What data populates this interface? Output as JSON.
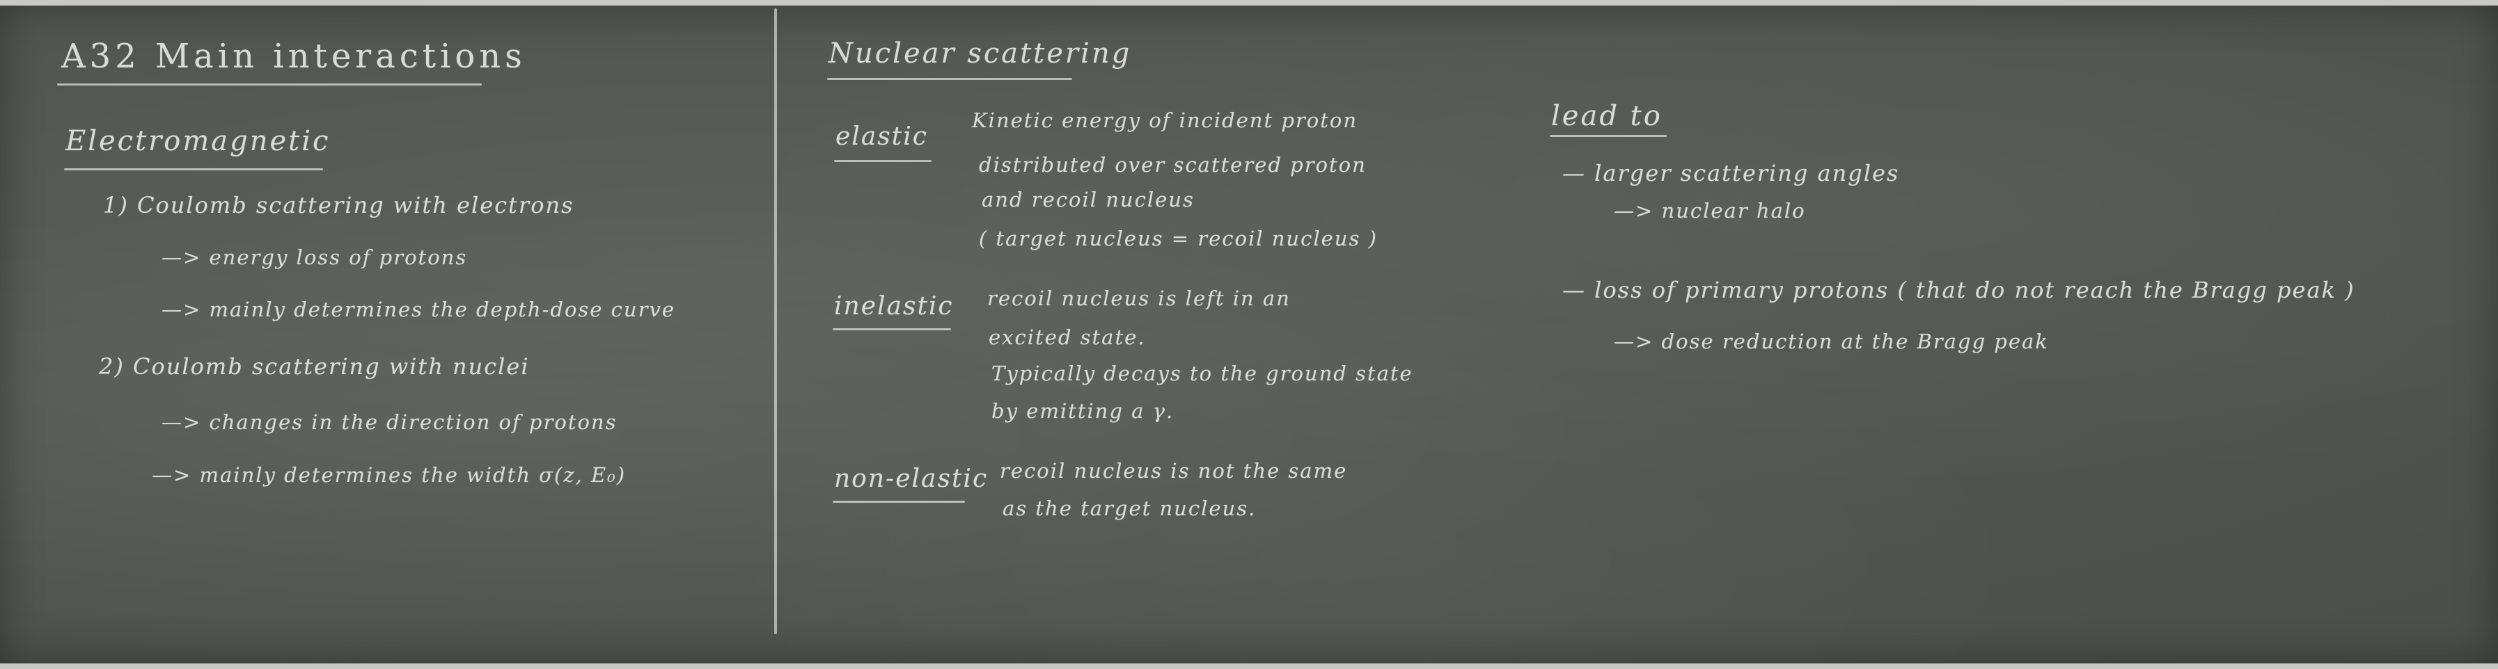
{
  "left": {
    "title": "A32  Main interactions",
    "section": "Electromagnetic",
    "lines": [
      "1)  Coulomb scattering with electrons",
      "—> energy loss of protons",
      "—> mainly determines the depth-dose curve",
      "2)  Coulomb scattering with nuclei",
      "—> changes in the direction of protons",
      "—> mainly determines the width σ(z, E₀)"
    ]
  },
  "middle": {
    "heading": "Nuclear scattering",
    "elastic": {
      "term": "elastic",
      "lines": [
        "Kinetic energy of incident proton",
        "distributed over scattered proton",
        "and recoil nucleus",
        "( target nucleus  =  recoil nucleus )"
      ]
    },
    "inelastic": {
      "term": "inelastic",
      "lines": [
        "recoil nucleus is left in an",
        "excited state.",
        "Typically decays to the ground state",
        "by emitting a γ."
      ]
    },
    "nonelastic": {
      "term": "non-elastic",
      "lines": [
        "recoil nucleus is not the same",
        "as the target nucleus."
      ]
    }
  },
  "right": {
    "heading": "lead to",
    "lines": [
      "—  larger scattering angles",
      "—> nuclear halo",
      "—  loss of primary protons  ( that do not reach the Bragg peak )",
      "—> dose reduction at the Bragg peak"
    ]
  },
  "colors": {
    "board": "#535653",
    "chalk": "#e4e6e2",
    "frame": "#c9c9c4"
  }
}
